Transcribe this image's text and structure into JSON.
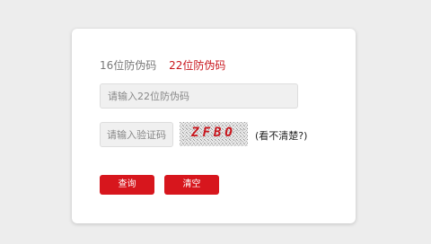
{
  "tabs": {
    "tab16": "16位防伪码",
    "tab22": "22位防伪码"
  },
  "code_input": {
    "placeholder": "请输入22位防伪码"
  },
  "captcha_input": {
    "placeholder": "请输入验证码"
  },
  "captcha": {
    "text": "ZFBO"
  },
  "refresh_link": "(看不清楚?)",
  "buttons": {
    "query": "查询",
    "clear": "清空"
  },
  "colors": {
    "accent": "#d7161d",
    "active_tab": "#c8161d",
    "inactive_tab": "#777777"
  }
}
